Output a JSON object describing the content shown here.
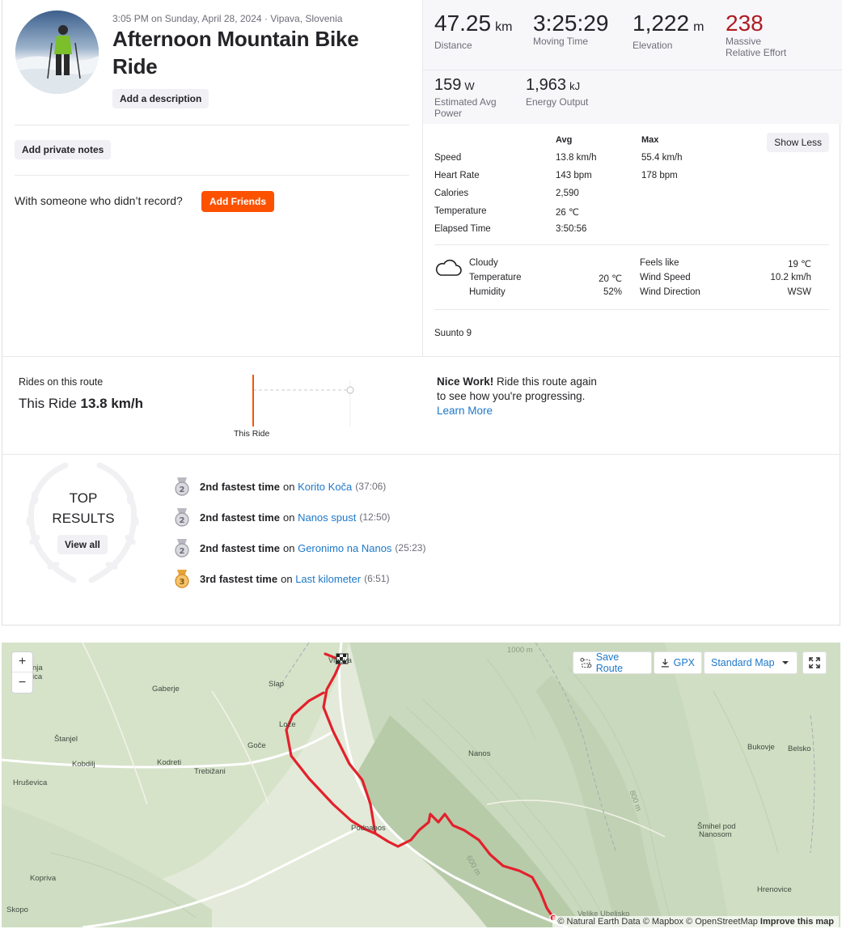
{
  "activity": {
    "meta": "3:05 PM on Sunday, April 28, 2024 · Vipava, Slovenia",
    "title": "Afternoon Mountain Bike Ride",
    "add_description": "Add a description",
    "add_private_notes": "Add private notes",
    "friends_question": "With someone who didn’t record?",
    "add_friends": "Add Friends"
  },
  "stats": {
    "distance": {
      "value": "47.25",
      "unit": "km",
      "label": "Distance"
    },
    "moving_time": {
      "value": "3:25:29",
      "label": "Moving Time"
    },
    "elevation": {
      "value": "1,222",
      "unit": "m",
      "label": "Elevation"
    },
    "effort": {
      "value": "238",
      "label_1": "Massive",
      "label_2": "Relative Effort"
    },
    "power": {
      "value": "159",
      "unit": "W",
      "label_1": "Estimated Avg",
      "label_2": "Power"
    },
    "energy": {
      "value": "1,963",
      "unit": "kJ",
      "label": "Energy Output"
    }
  },
  "details_table": {
    "avg_header": "Avg",
    "max_header": "Max",
    "show_less": "Show Less",
    "rows": [
      {
        "label": "Speed",
        "avg": "13.8 km/h",
        "max": "55.4 km/h"
      },
      {
        "label": "Heart Rate",
        "avg": "143 bpm",
        "max": "178 bpm"
      },
      {
        "label": "Calories",
        "avg": "2,590",
        "max": ""
      },
      {
        "label": "Temperature",
        "avg": "26 ℃",
        "max": ""
      },
      {
        "label": "Elapsed Time",
        "avg": "3:50:56",
        "max": ""
      }
    ]
  },
  "weather": {
    "icon": "cloud-icon",
    "condition": "Cloudy",
    "temperature_label": "Temperature",
    "temperature": "20 ℃",
    "humidity_label": "Humidity",
    "humidity": "52%",
    "feels_like_label": "Feels like",
    "feels_like": "19 ℃",
    "wind_speed_label": "Wind Speed",
    "wind_speed": "10.2 km/h",
    "wind_dir_label": "Wind Direction",
    "wind_dir": "WSW"
  },
  "device": "Suunto 9",
  "route_compare": {
    "heading": "Rides on this route",
    "this_ride_prefix": "This Ride",
    "this_ride_speed": "13.8 km/h",
    "marker_label": "This Ride",
    "nice_work": "Nice Work!",
    "nice_text_1": "Ride this route again",
    "nice_text_2": "to see how you're progressing.",
    "learn_more": "Learn More"
  },
  "top_results": {
    "title_1": "TOP",
    "title_2": "RESULTS",
    "view_all": "View all",
    "items": [
      {
        "rank": "2",
        "text": "2nd fastest time",
        "on": "on",
        "segment": "Korito Koča",
        "time": "(37:06)",
        "medal": "silver"
      },
      {
        "rank": "2",
        "text": "2nd fastest time",
        "on": "on",
        "segment": "Nanos spust",
        "time": "(12:50)",
        "medal": "silver"
      },
      {
        "rank": "2",
        "text": "2nd fastest time",
        "on": "on",
        "segment": "Geronimo na Nanos",
        "time": "(25:23)",
        "medal": "silver"
      },
      {
        "rank": "3",
        "text": "3rd fastest time",
        "on": "on",
        "segment": "Last kilometer",
        "time": "(6:51)",
        "medal": "bronze"
      }
    ]
  },
  "map": {
    "zoom_in": "+",
    "zoom_out": "−",
    "save_route": "Save Route",
    "gpx": "GPX",
    "map_type": "Standard Map",
    "places": [
      "Vipava",
      "Slap",
      "Gaberje",
      "Lože",
      "Goče",
      "Štanjel",
      "Kobdilj",
      "Kodreti",
      "Trebižani",
      "Hruševica",
      "Podnanos",
      "Nanos",
      "Bukovje",
      "Belsko",
      "Šmihel pod",
      "Nanosom",
      "Kopriva",
      "Hrenovice",
      "Skopo",
      "Velike Ubeljsko",
      "nja",
      "ica",
      "800 m",
      "600 m",
      "1000 m"
    ],
    "attribution": "© Natural Earth Data © Mapbox © OpenStreetMap",
    "improve": "Improve this map"
  },
  "colors": {
    "brand_orange": "#fc5200",
    "link_blue": "#1e78c8",
    "effort_red": "#b01c23",
    "route_red": "#e3212c"
  }
}
